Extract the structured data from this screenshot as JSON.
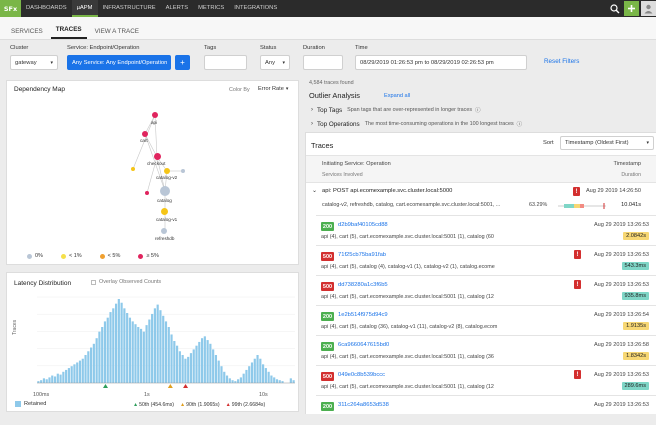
{
  "nav": {
    "logo": "SFx",
    "items": [
      "DASHBOARDS",
      "µAPM",
      "INFRASTRUCTURE",
      "ALERTS",
      "METRICS",
      "INTEGRATIONS"
    ]
  },
  "tabs": [
    "SERVICES",
    "TRACES",
    "VIEW A TRACE"
  ],
  "filters": {
    "cluster_label": "Cluster",
    "cluster_value": "gateway",
    "service_label": "Service: Endpoint/Operation",
    "service_value": "Any Service: Any Endpoint/Operation",
    "add": "+",
    "tags_label": "Tags",
    "status_label": "Status",
    "status_value": "Any",
    "duration_label": "Duration",
    "time_label": "Time",
    "time_value": "08/29/2019 01:26:53 pm to 08/29/2019 02:26:53 pm",
    "reset": "Reset Filters"
  },
  "dependency": {
    "title": "Dependency Map",
    "colorby_label": "Color By",
    "colorby_value": "Error Rate",
    "nodes": [
      "api",
      "cart",
      "checkout",
      "catalog-v2",
      "catalog",
      "catalog-v1",
      "refreshdb"
    ],
    "legend": [
      "0%",
      "< 1%",
      "< 5%",
      "≥ 5%"
    ]
  },
  "latency": {
    "title": "Latency Distribution",
    "overlay": "Overlay Observed Counts",
    "ylabel": "Traces",
    "xlabels": [
      "100ms",
      "1s",
      "10s"
    ],
    "retained": "Retained",
    "p50": "50th (454.6ms)",
    "p90": "90th (1.9065s)",
    "p99": "99th (2.6684s)"
  },
  "chart_data": {
    "type": "bar",
    "title": "Latency Distribution",
    "ylabel": "Traces",
    "xscale": "log",
    "xlim_ms": [
      100,
      30000
    ],
    "series": [
      {
        "name": "Retained",
        "values": [
          2,
          3,
          5,
          4,
          6,
          8,
          7,
          10,
          9,
          12,
          14,
          16,
          18,
          20,
          22,
          24,
          26,
          30,
          34,
          38,
          42,
          48,
          55,
          60,
          66,
          70,
          76,
          80,
          85,
          90,
          86,
          80,
          75,
          70,
          66,
          63,
          60,
          58,
          55,
          62,
          68,
          74,
          80,
          84,
          78,
          72,
          66,
          60,
          52,
          45,
          40,
          34,
          30,
          26,
          28,
          32,
          36,
          40,
          44,
          48,
          50,
          46,
          42,
          36,
          30,
          24,
          18,
          12,
          8,
          5,
          3,
          2,
          4,
          6,
          10,
          14,
          18,
          22,
          26,
          30,
          26,
          20,
          16,
          12,
          8,
          6,
          4,
          3,
          2,
          0,
          0,
          5,
          3
        ]
      }
    ],
    "percentiles": {
      "p50_ms": 454.6,
      "p90_ms": 1906.5,
      "p99_ms": 2668.4
    }
  },
  "outlier": {
    "found": "4,584 traces found",
    "title": "Outlier Analysis",
    "expand": "Expand all",
    "top_tags": "Top Tags",
    "top_tags_desc": "Span tags that are over-represented in longer traces",
    "top_ops": "Top Operations",
    "top_ops_desc": "The most time-consuming operations in the 100 longest traces"
  },
  "traces": {
    "title": "Traces",
    "sort_label": "Sort",
    "sort_value": "Timestamp (Oldest First)",
    "col_initiating": "Initiating Service: Operation",
    "col_services": "Services Involved",
    "col_timestamp": "Timestamp",
    "col_duration": "Duration",
    "expanded": {
      "op": "api: POST api.ecomexample.svc.cluster.local:5000",
      "services": "catalog-v2, refreshdb, catalog, cart.ecomexample.svc.cluster.local:5001, ...",
      "timestamp": "Aug 29 2019 14:26:50",
      "pct": "63.29%",
      "dur": "10.041s"
    },
    "rows": [
      {
        "status": "200",
        "id": "d2b9baf40105cd88",
        "ts": "Aug 29 2019 13:26:53",
        "summary": "api (4), cart (5), cart.ecomexample.svc.cluster.local:5001 (1), catalog (60",
        "dur": "2.0842s",
        "color": "#f7d774",
        "error": false
      },
      {
        "status": "500",
        "id": "71f25cb75ba91fab",
        "ts": "Aug 29 2019 13:26:53",
        "summary": "api (4), cart (5), catalog (4), catalog-v1 (1), catalog-v2 (1), catalog.ecome",
        "dur": "543.3ms",
        "color": "#7fd6c7",
        "error": true
      },
      {
        "status": "500",
        "id": "dd738280a1c3f6b5",
        "ts": "Aug 29 2019 13:26:53",
        "summary": "api (4), cart (5), cart.ecomexample.svc.cluster.local:5001 (1), catalog (12",
        "dur": "935.8ms",
        "color": "#7fd6c7",
        "error": true
      },
      {
        "status": "200",
        "id": "1e2b514f975d94c9",
        "ts": "Aug 29 2019 13:26:54",
        "summary": "api (4), cart (5), catalog (36), catalog-v1 (11), catalog-v2 (8), catalog.ecom",
        "dur": "1.9135s",
        "color": "#f7d774",
        "error": false
      },
      {
        "status": "200",
        "id": "6ca9660647615bd0",
        "ts": "Aug 29 2019 13:26:58",
        "summary": "api (4), cart (5), cart.ecomexample.svc.cluster.local:5001 (1), catalog (36",
        "dur": "1.8342s",
        "color": "#f7d774",
        "error": false
      },
      {
        "status": "500",
        "id": "049e0c8b539bccc",
        "ts": "Aug 29 2019 13:26:53",
        "summary": "api (4), cart (5), cart.ecomexample.svc.cluster.local:5001 (1), catalog (12",
        "dur": "289.6ms",
        "color": "#7fd6c7",
        "error": true
      },
      {
        "status": "200",
        "id": "311c264a8653d538",
        "ts": "Aug 29 2019 13:26:53",
        "summary": "",
        "dur": "",
        "color": "#7fd6c7",
        "error": false
      }
    ]
  },
  "colors": {
    "accent": "#1a73e8",
    "ok": "#4caf50",
    "error": "#d32f2f",
    "nav": "#2b2b2b",
    "logo": "#7ab648",
    "bar": "#8ec9ea"
  }
}
